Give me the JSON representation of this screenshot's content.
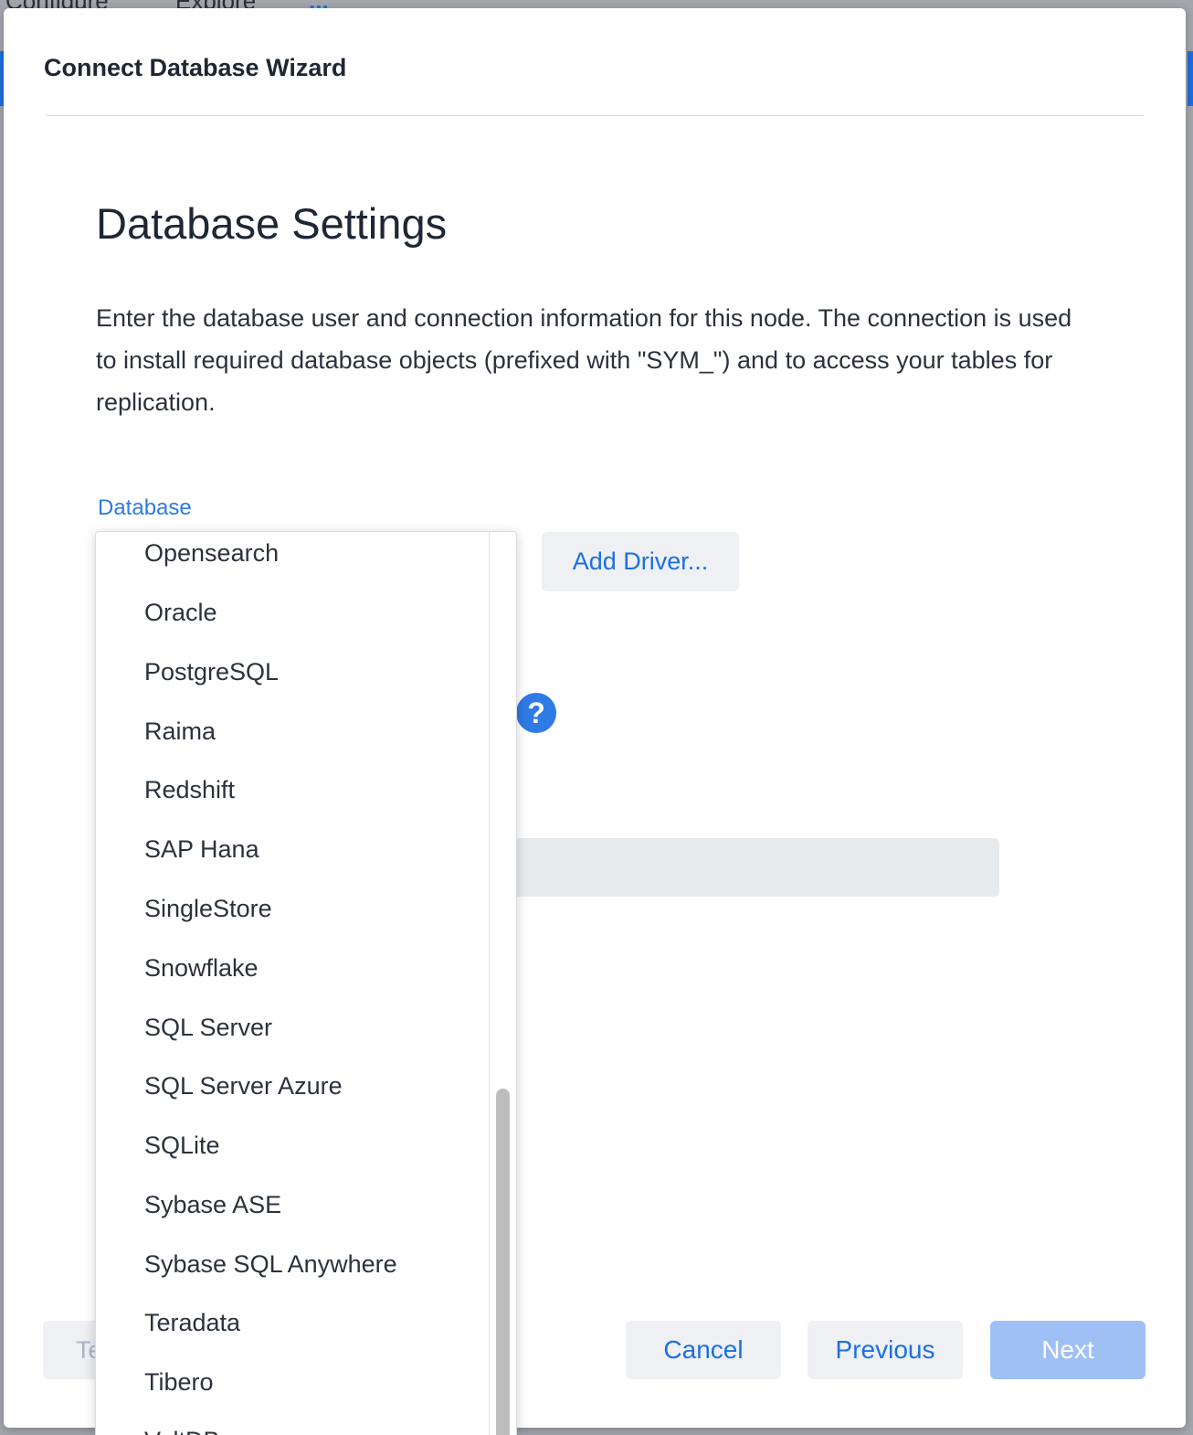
{
  "background": {
    "tabs": [
      "Configure",
      "Explore",
      "..."
    ]
  },
  "dialog": {
    "title": "Connect Database Wizard",
    "section_title": "Database Settings",
    "description": "Enter the database user and connection information for this node. The connection is used to install required database objects (prefixed with \"SYM_\") and to access your tables for replication.",
    "database_label": "Database",
    "add_driver_label": "Add Driver...",
    "help_icon": "?",
    "test_label": "Te",
    "cancel_label": "Cancel",
    "previous_label": "Previous",
    "next_label": "Next"
  },
  "dropdown": {
    "items": [
      "Opensearch",
      "Oracle",
      "PostgreSQL",
      "Raima",
      "Redshift",
      "SAP Hana",
      "SingleStore",
      "Snowflake",
      "SQL Server",
      "SQL Server Azure",
      "SQLite",
      "Sybase ASE",
      "Sybase SQL Anywhere",
      "Teradata",
      "Tibero",
      "VoltDB"
    ]
  },
  "colors": {
    "accent": "#1d6fe0",
    "label_blue": "#2f7ae5",
    "next_disabled": "#9fc0f4",
    "text_dark": "#1f2733"
  }
}
